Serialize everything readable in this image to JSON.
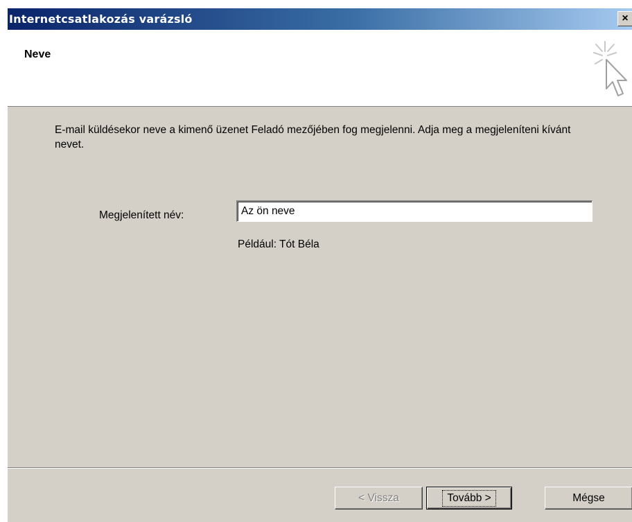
{
  "window": {
    "title": "Internetcsatlakozás varázsló",
    "close_glyph": "×"
  },
  "header": {
    "title": "Neve",
    "icon": "wizard-cursor-icon"
  },
  "content": {
    "description": "E-mail küldésekor neve a kimenő üzenet Feladó mezőjében fog megjelenni. Adja meg a megjeleníteni kívánt nevet.",
    "name_label": "Megjelenített név:",
    "name_value": "Az ön neve",
    "example": "Például: Tót Béla"
  },
  "buttons": {
    "back": "< Vissza",
    "next": "Tovább >",
    "cancel": "Mégse"
  },
  "colors": {
    "title_gradient_start": "#0a246a",
    "title_gradient_end": "#a6caf0",
    "dialog_face": "#d4d0c8"
  }
}
